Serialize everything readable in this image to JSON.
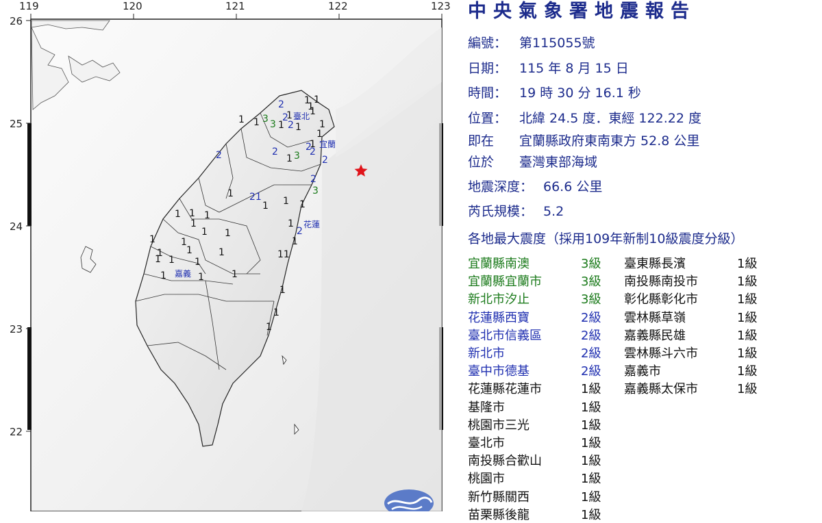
{
  "map": {
    "lon_ticks": [
      "119",
      "120",
      "121",
      "122",
      "123"
    ],
    "lat_ticks": [
      "26",
      "25",
      "24",
      "23",
      "22"
    ],
    "city_labels": [
      "臺北",
      "宜蘭",
      "花蓮",
      "嘉義"
    ],
    "epicenter_marker": "red-star",
    "markers": [
      {
        "v": "2",
        "c": "2"
      },
      {
        "v": "1",
        "c": "1"
      },
      {
        "v": "1",
        "c": "1"
      },
      {
        "v": "1",
        "c": "1"
      },
      {
        "v": "2",
        "c": "2"
      },
      {
        "v": "1",
        "c": "1"
      },
      {
        "v": "2",
        "c": "2"
      },
      {
        "v": "1",
        "c": "1"
      },
      {
        "v": "1",
        "c": "1"
      },
      {
        "v": "1",
        "c": "1"
      },
      {
        "v": "1",
        "c": "1"
      },
      {
        "v": "1",
        "c": "1"
      },
      {
        "v": "1",
        "c": "1"
      },
      {
        "v": "3",
        "c": "3"
      },
      {
        "v": "3",
        "c": "3"
      },
      {
        "v": "1",
        "c": "1"
      },
      {
        "v": "1",
        "c": "1"
      },
      {
        "v": "2",
        "c": "2"
      },
      {
        "v": "2",
        "c": "2"
      },
      {
        "v": "2",
        "c": "2"
      },
      {
        "v": "1",
        "c": "1"
      },
      {
        "v": "3",
        "c": "3"
      },
      {
        "v": "2",
        "c": "2"
      },
      {
        "v": "3",
        "c": "3"
      },
      {
        "v": "2",
        "c": "2"
      },
      {
        "v": "1",
        "c": "1"
      },
      {
        "v": "21",
        "c": "2"
      },
      {
        "v": "1",
        "c": "1"
      },
      {
        "v": "2",
        "c": "2"
      },
      {
        "v": "1",
        "c": "1"
      },
      {
        "v": "1",
        "c": "1"
      },
      {
        "v": "1",
        "c": "1"
      },
      {
        "v": "1",
        "c": "1"
      },
      {
        "v": "1",
        "c": "1"
      },
      {
        "v": "1",
        "c": "1"
      },
      {
        "v": "1",
        "c": "1"
      },
      {
        "v": "1",
        "c": "1"
      },
      {
        "v": "1",
        "c": "1"
      },
      {
        "v": "1",
        "c": "1"
      },
      {
        "v": "1",
        "c": "1"
      },
      {
        "v": "1",
        "c": "1"
      },
      {
        "v": "1",
        "c": "1"
      },
      {
        "v": "1",
        "c": "1"
      },
      {
        "v": "1",
        "c": "1"
      },
      {
        "v": "1",
        "c": "1"
      },
      {
        "v": "1",
        "c": "1"
      },
      {
        "v": "2",
        "c": "2"
      },
      {
        "v": "1",
        "c": "1"
      },
      {
        "v": "11",
        "c": "1"
      },
      {
        "v": "1",
        "c": "1"
      },
      {
        "v": "1",
        "c": "1"
      },
      {
        "v": "1",
        "c": "1"
      },
      {
        "v": "1",
        "c": "1"
      },
      {
        "v": "1",
        "c": "1"
      },
      {
        "v": "1",
        "c": "1"
      }
    ]
  },
  "report": {
    "title": "中央氣象署地震報告",
    "number_label": "編號：",
    "number_value": "第115055號",
    "date_label": "日期：",
    "date_value": "115 年 8 月 15 日",
    "time_label": "時間：",
    "time_value": "19 時 30 分 16.1 秒",
    "position_label": "位置：",
    "position_value": "北緯 24.5 度．東經 122.22 度",
    "relative_label": "即在",
    "relative_value": "宜蘭縣政府東南東方 52.8 公里",
    "region_label": "位於",
    "region_value": "臺灣東部海域",
    "depth_label": "地震深度：",
    "depth_value": "66.6 公里",
    "magnitude_label": "芮氏規模：",
    "magnitude_value": "5.2",
    "intensity_heading": "各地最大震度（採用109年新制10級震度分級）",
    "intensities_left": [
      {
        "loc": "宜蘭縣南澳",
        "level": "3級",
        "c": "3"
      },
      {
        "loc": "宜蘭縣宜蘭市",
        "level": "3級",
        "c": "3"
      },
      {
        "loc": "新北市汐止",
        "level": "3級",
        "c": "3"
      },
      {
        "loc": "花蓮縣西寶",
        "level": "2級",
        "c": "2"
      },
      {
        "loc": "臺北市信義區",
        "level": "2級",
        "c": "2"
      },
      {
        "loc": "新北市",
        "level": "2級",
        "c": "2"
      },
      {
        "loc": "臺中市德基",
        "level": "2級",
        "c": "2"
      },
      {
        "loc": "花蓮縣花蓮市",
        "level": "1級",
        "c": "1"
      },
      {
        "loc": "基隆市",
        "level": "1級",
        "c": "1"
      },
      {
        "loc": "桃園市三光",
        "level": "1級",
        "c": "1"
      },
      {
        "loc": "臺北市",
        "level": "1級",
        "c": "1"
      },
      {
        "loc": "南投縣合歡山",
        "level": "1級",
        "c": "1"
      },
      {
        "loc": "桃園市",
        "level": "1級",
        "c": "1"
      },
      {
        "loc": "新竹縣關西",
        "level": "1級",
        "c": "1"
      },
      {
        "loc": "苗栗縣後龍",
        "level": "1級",
        "c": "1"
      }
    ],
    "intensities_right": [
      {
        "loc": "臺東縣長濱",
        "level": "1級",
        "c": "1"
      },
      {
        "loc": "南投縣南投市",
        "level": "1級",
        "c": "1"
      },
      {
        "loc": "彰化縣彰化市",
        "level": "1級",
        "c": "1"
      },
      {
        "loc": "雲林縣草嶺",
        "level": "1級",
        "c": "1"
      },
      {
        "loc": "嘉義縣民雄",
        "level": "1級",
        "c": "1"
      },
      {
        "loc": "雲林縣斗六市",
        "level": "1級",
        "c": "1"
      },
      {
        "loc": "嘉義市",
        "level": "1級",
        "c": "1"
      },
      {
        "loc": "嘉義縣太保市",
        "level": "1級",
        "c": "1"
      }
    ]
  },
  "colors": {
    "title": "#1c2b8c",
    "level3": "#1a7a1a",
    "level2": "#1f2fb0",
    "level1": "#111111",
    "star": "#e0141a"
  }
}
